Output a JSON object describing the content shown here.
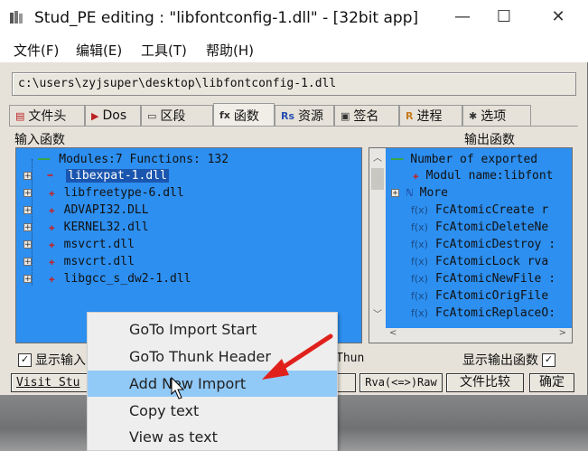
{
  "window": {
    "title": "Stud_PE editing : \"libfontconfig-1.dll\" - [32bit app]",
    "min_label": "—",
    "max_label": "☐",
    "close_label": "✕"
  },
  "menu": [
    "文件(F)",
    "编辑(E)",
    "工具(T)",
    "帮助(H)"
  ],
  "path": "c:\\users\\zyjsuper\\desktop\\libfontconfig-1.dll",
  "tabs": [
    {
      "label": "文件头",
      "icon": "📋"
    },
    {
      "label": "Dos",
      "icon": "▶"
    },
    {
      "label": "区段",
      "icon": "▭"
    },
    {
      "label": "函数",
      "icon": "fx"
    },
    {
      "label": "资源",
      "icon": "Rs"
    },
    {
      "label": "签名",
      "icon": "✎"
    },
    {
      "label": "进程",
      "icon": "R"
    },
    {
      "label": "选项",
      "icon": "✱"
    }
  ],
  "active_tab_index": 3,
  "left_panel": {
    "heading": "输入函数",
    "summary": "Modules:7 Functions: 132",
    "modules": [
      "libexpat-1.dll",
      "libfreetype-6.dll",
      "ADVAPI32.DLL",
      "KERNEL32.dll",
      "msvcrt.dll",
      "msvcrt.dll",
      "libgcc_s_dw2-1.dll"
    ],
    "selected_index": 0
  },
  "right_panel": {
    "heading": "输出函数",
    "header_rows": [
      "Number of exported",
      "Modul name:libfont",
      "More"
    ],
    "functions": [
      "FcAtomicCreate r",
      "FcAtomicDeleteNe",
      "FcAtomicDestroy :",
      "FcAtomicLock rva",
      "FcAtomicNewFile :",
      "FcAtomicOrigFile",
      "FcAtomicReplaceO:"
    ]
  },
  "checkboxes": {
    "show_input": "显示输入",
    "show_output": "显示输出函数"
  },
  "bottom_buttons": {
    "visit": "Visit Stu",
    "thunk": "Thun",
    "rva_raw": "Rva(<=>)Raw",
    "compare": "文件比较",
    "ok": "确定"
  },
  "context_menu": [
    "GoTo Import Start",
    "GoTo Thunk Header",
    "Add New Import",
    "Copy text",
    "View as text"
  ],
  "context_menu_highlight": 2,
  "colors": {
    "panel_bg": "#2d8ff0",
    "selection": "#1a56b0",
    "menu_highlight": "#91c9f7",
    "arrow": "#e0211b"
  }
}
